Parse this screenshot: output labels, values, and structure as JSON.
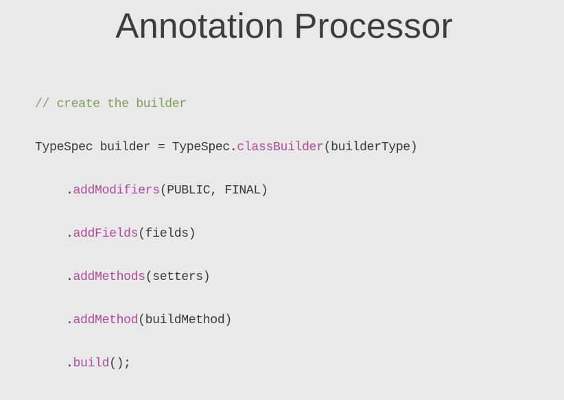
{
  "slide": {
    "title": "Annotation Processor"
  },
  "code": {
    "comment": "// create the builder",
    "line1": {
      "prefix": "TypeSpec builder = TypeSpec.",
      "method": "classBuilder",
      "suffix": "(builderType)"
    },
    "chain": [
      {
        "dot": ".",
        "method": "addModifiers",
        "args": "(PUBLIC, FINAL)"
      },
      {
        "dot": ".",
        "method": "addFields",
        "args": "(fields)"
      },
      {
        "dot": ".",
        "method": "addMethods",
        "args": "(setters)"
      },
      {
        "dot": ".",
        "method": "addMethod",
        "args": "(buildMethod)"
      },
      {
        "dot": ".",
        "method": "build",
        "args": "();"
      }
    ]
  },
  "colors": {
    "background": "#e9e9e9",
    "title": "#3d3d3d",
    "code_text": "#3a3a3a",
    "comment": "#7fa05a",
    "method": "#b04a9c"
  }
}
